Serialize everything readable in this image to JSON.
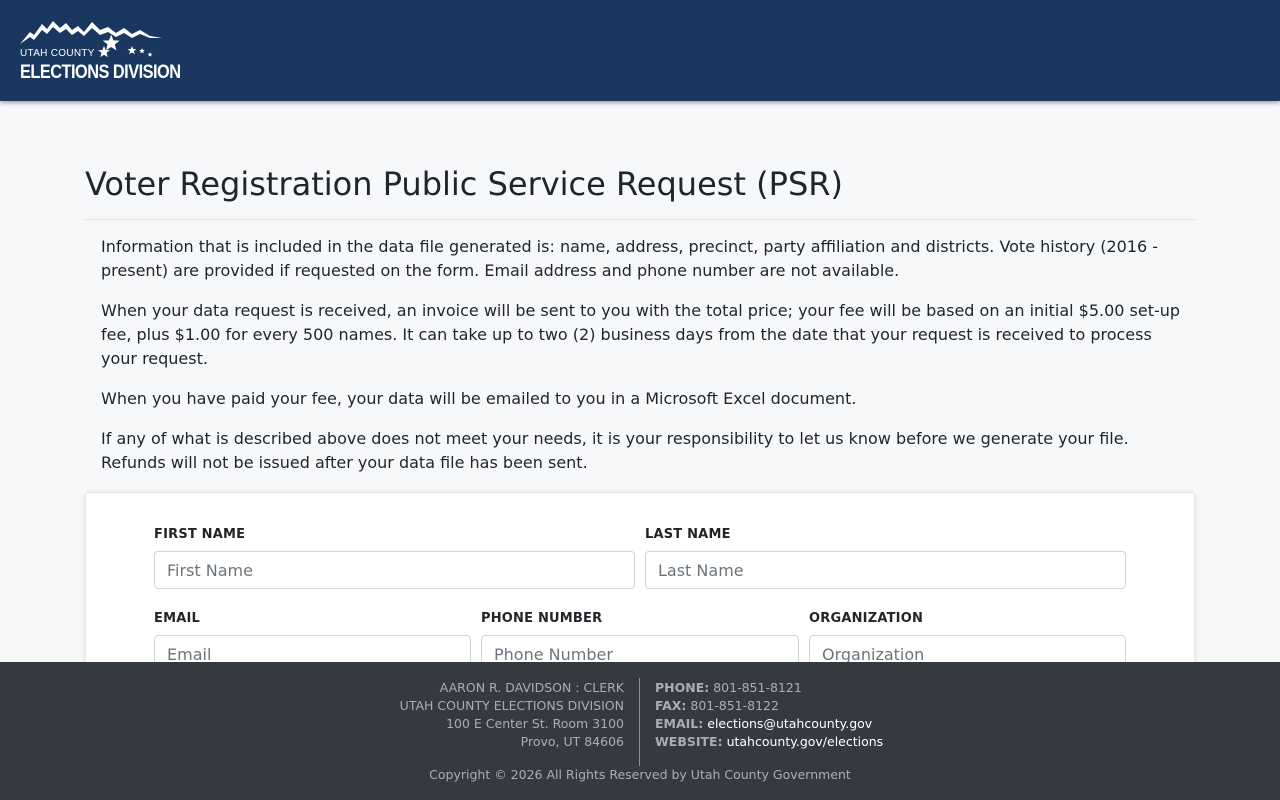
{
  "header": {
    "logo_small": "UTAH COUNTY",
    "logo_big": "ELECTIONS DIVISION"
  },
  "page": {
    "title": "Voter Registration Public Service Request (PSR)",
    "paragraphs": [
      "Information that is included in the data file generated is: name, address, precinct, party affiliation and districts. Vote history (2016 - present) are provided if requested on the form. Email address and phone number are not available.",
      "When your data request is received, an invoice will be sent to you with the total price; your fee will be based on an initial $5.00 set-up fee, plus $1.00 for every 500 names. It can take up to two (2) business days from the date that your request is received to process your request.",
      "When you have paid your fee, your data will be emailed to you in a Microsoft Excel document.",
      "If any of what is described above does not meet your needs, it is your responsibility to let us know before we generate your file. Refunds will not be issued after your data file has been sent."
    ]
  },
  "form": {
    "first_name": {
      "label": "FIRST NAME",
      "placeholder": "First Name",
      "value": ""
    },
    "last_name": {
      "label": "LAST NAME",
      "placeholder": "Last Name",
      "value": ""
    },
    "email": {
      "label": "EMAIL",
      "placeholder": "Email",
      "value": ""
    },
    "phone": {
      "label": "PHONE NUMBER",
      "placeholder": "Phone Number",
      "value": ""
    },
    "organization": {
      "label": "ORGANIZATION",
      "placeholder": "Organization",
      "value": ""
    }
  },
  "footer": {
    "left_lines": [
      "AARON R. DAVIDSON : CLERK",
      "UTAH COUNTY ELECTIONS DIVISION",
      "100 E Center St. Room 3100",
      "Provo, UT 84606"
    ],
    "phone_label": "PHONE:",
    "phone_value": "801-851-8121",
    "fax_label": "FAX:",
    "fax_value": "801-851-8122",
    "email_label": "EMAIL:",
    "email_value": "elections@utahcounty.gov",
    "website_label": "WEBSITE:",
    "website_value": "utahcounty.gov/elections",
    "copyright": "Copyright © 2026 All Rights Reserved by Utah County Government"
  },
  "colors": {
    "header_bg": "#1a375f",
    "footer_bg": "#343a40",
    "page_bg": "#f7f8f9"
  }
}
